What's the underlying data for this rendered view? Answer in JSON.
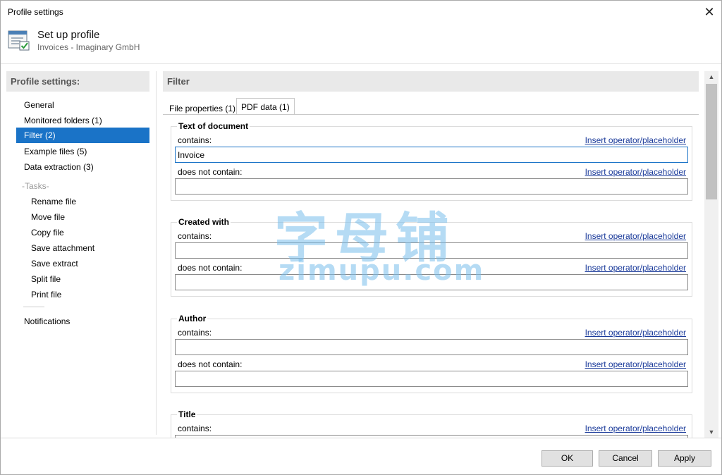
{
  "window": {
    "title": "Profile settings",
    "close_glyph": "✕"
  },
  "header": {
    "title": "Set up profile",
    "subtitle": "Invoices - Imaginary GmbH",
    "icon": "profile-settings-icon"
  },
  "sidebar": {
    "heading": "Profile settings:",
    "items": [
      {
        "label": "General"
      },
      {
        "label": "Monitored folders (1)"
      },
      {
        "label": "Filter (2)",
        "active": true
      },
      {
        "label": "Example files (5)"
      },
      {
        "label": "Data extraction (3)"
      }
    ],
    "tasks_label": "-Tasks-",
    "tasks": [
      {
        "label": "Rename file"
      },
      {
        "label": "Move file"
      },
      {
        "label": "Copy file"
      },
      {
        "label": "Save attachment"
      },
      {
        "label": "Save extract"
      },
      {
        "label": "Split file"
      },
      {
        "label": "Print file"
      }
    ],
    "notifications": "Notifications"
  },
  "main": {
    "heading": "Filter",
    "tabs": [
      {
        "label": "File properties (1)"
      },
      {
        "label": "PDF data (1)",
        "active": true
      }
    ],
    "link_label": "Insert operator/placeholder",
    "contains_label": "contains:",
    "not_contains_label": "does not contain:",
    "groups": [
      {
        "title": "Text of document",
        "contains": "Invoice",
        "not_contains": ""
      },
      {
        "title": "Created with",
        "contains": "",
        "not_contains": ""
      },
      {
        "title": "Author",
        "contains": "",
        "not_contains": ""
      },
      {
        "title": "Title",
        "contains": "",
        "not_contains": ""
      }
    ]
  },
  "buttons": {
    "ok": "OK",
    "cancel": "Cancel",
    "apply": "Apply"
  },
  "watermark": {
    "cjk": "字母铺",
    "latin": "zimupu.com"
  },
  "colors": {
    "accent": "#1a73c7",
    "link": "#1a3a9a"
  }
}
